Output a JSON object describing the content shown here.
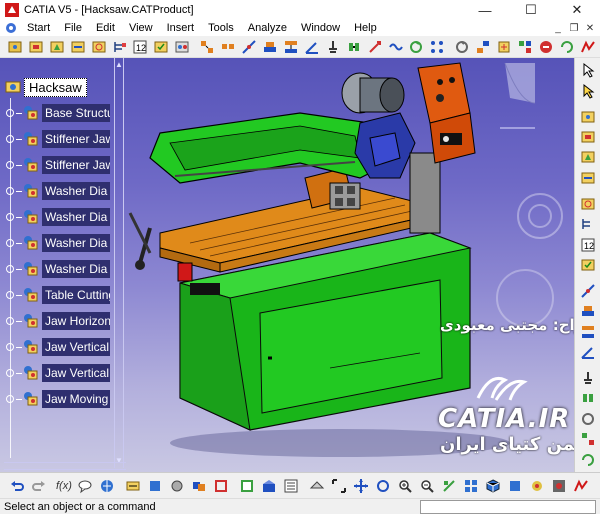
{
  "window": {
    "title": "CATIA V5 - [Hacksaw.CATProduct]",
    "minimize_glyph": "—",
    "maximize_glyph": "☐",
    "close_glyph": "✕"
  },
  "menu": {
    "items": [
      "Start",
      "File",
      "Edit",
      "View",
      "Insert",
      "Tools",
      "Analyze",
      "Window",
      "Help"
    ],
    "mdi_min": "_",
    "mdi_restore": "❐",
    "mdi_close": "✕"
  },
  "tree": {
    "root": "Hacksaw",
    "items": [
      "Base Structure",
      "Stiffener Jaw",
      "Stiffener Jaw",
      "Washer Dia",
      "Washer Dia",
      "Washer Dia",
      "Washer Dia",
      "Table Cutting",
      "Jaw Horizontal",
      "Jaw Vertical",
      "Jaw Vertical",
      "Jaw Moving"
    ]
  },
  "watermark": {
    "designer": "طراح: مجتبی معبودی",
    "site": "CATIA.IR",
    "society": "انجمن کتیای ایران"
  },
  "bottom_toolbar": {
    "fx_label": "f(x)"
  },
  "status": {
    "prompt": "Select an object or a command"
  },
  "colors": {
    "viewport_top": "#5653b8",
    "viewport_bottom": "#c9c8e3",
    "machine_green": "#1fcf1f",
    "machine_orange": "#e08a1a",
    "panel_orange": "#e05a10",
    "tree_label_bg": "#2f2f6f"
  },
  "icons": {
    "app": "catia-app-icon",
    "tree_node": "product-gear-icon",
    "compass": "compass-icon"
  }
}
